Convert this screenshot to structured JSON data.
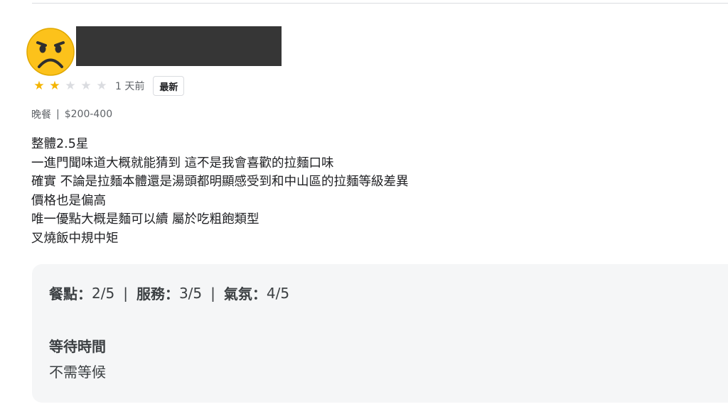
{
  "review": {
    "avatar_icon": "sad-face-emoji-icon",
    "rating": {
      "stars_filled": 2,
      "stars_total": 5
    },
    "time": "1 天前",
    "badge": "最新",
    "meal_type": "晚餐",
    "price_range": "$200-400",
    "text_lines": [
      "整體2.5星",
      "一進門聞味道大概就能猜到 這不是我會喜歡的拉麵口味",
      "確實 不論是拉麵本體還是湯頭都明顯感受到和中山區的拉麵等級差異",
      "價格也是偏高",
      "唯一優點大概是麵可以續 屬於吃粗飽類型",
      "叉燒飯中規中矩"
    ],
    "details": {
      "food_label": "餐點：",
      "food_value": "2/5",
      "service_label": "服務：",
      "service_value": "3/5",
      "atmosphere_label": "氣氛：",
      "atmosphere_value": "4/5",
      "separator": "|",
      "wait_title": "等待時間",
      "wait_value": "不需等候"
    }
  },
  "colors": {
    "star_filled": "#f4b400",
    "star_empty": "#dadce0",
    "card_background": "#f5f6f7",
    "redaction": "#363636"
  }
}
